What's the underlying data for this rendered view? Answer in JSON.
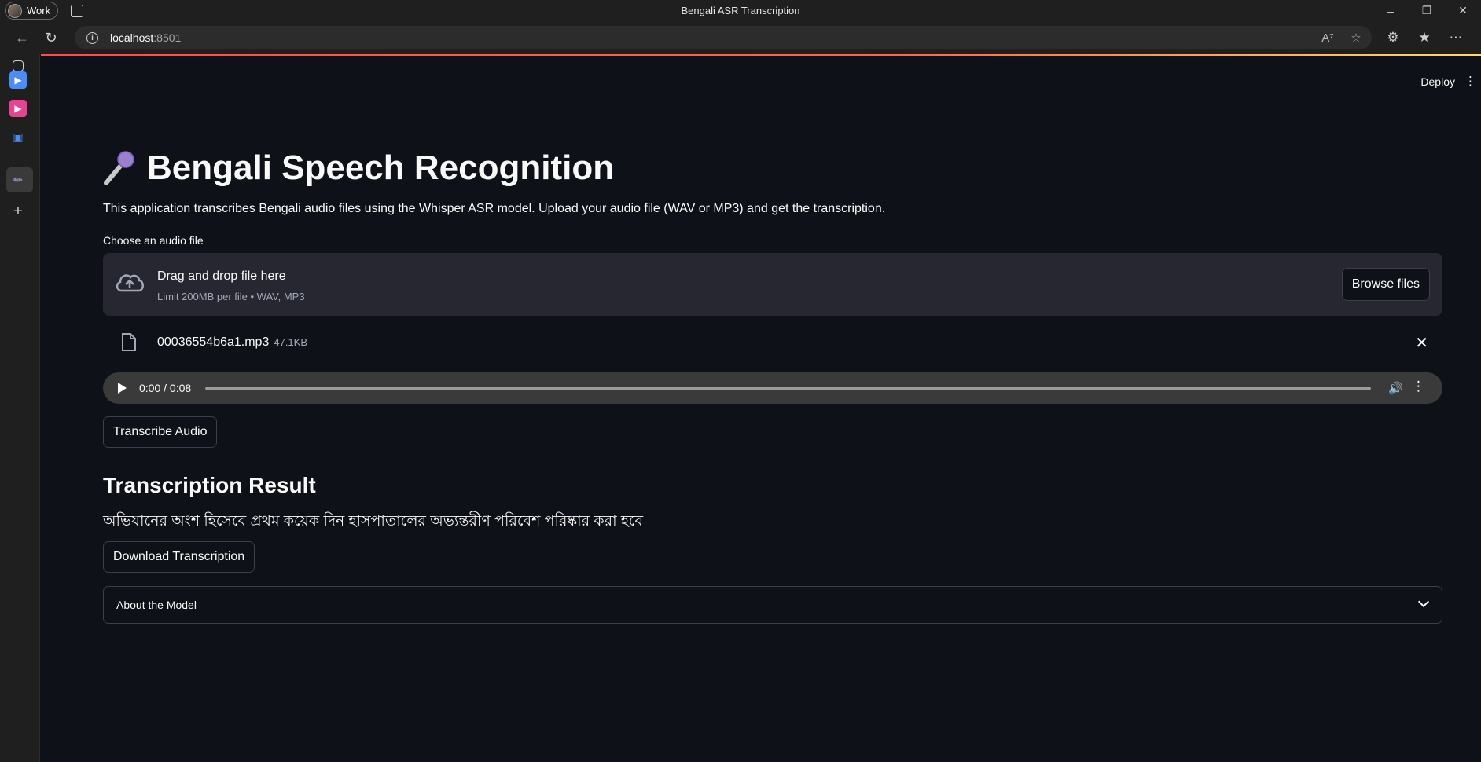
{
  "browser": {
    "profile_label": "Work",
    "window_title": "Bengali ASR Transcription",
    "url_host": "localhost",
    "url_port": ":8501"
  },
  "app": {
    "deploy_label": "Deploy",
    "title": "Bengali Speech Recognition",
    "description": "This application transcribes Bengali audio files using the Whisper ASR model. Upload your audio file (WAV or MP3) and get the transcription.",
    "uploader": {
      "label": "Choose an audio file",
      "drop_text": "Drag and drop file here",
      "limit_text": "Limit 200MB per file • WAV, MP3",
      "browse_label": "Browse files"
    },
    "uploaded_file": {
      "name": "00036554b6a1.mp3",
      "size": "47.1KB"
    },
    "audio_player": {
      "time": "0:00 / 0:08"
    },
    "transcribe_label": "Transcribe Audio",
    "result_heading": "Transcription Result",
    "result_text": "অভিযানের অংশ হিসেবে প্রথম কয়েক দিন হাসপাতালের অভ্যন্তরীণ পরিবেশ পরিষ্কার করা হবে",
    "download_label": "Download Transcription",
    "expander_label": "About the Model"
  },
  "colors": {
    "background": "#0e1117",
    "dropzone": "#262730",
    "accent": "#ff4b4b"
  }
}
